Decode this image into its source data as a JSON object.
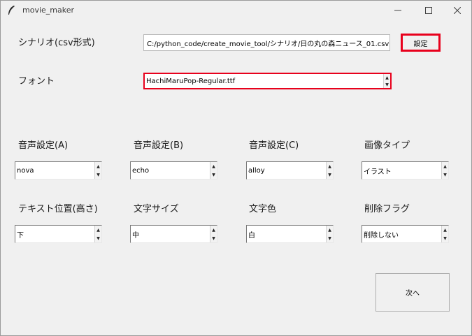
{
  "window": {
    "title": "movie_maker",
    "icon": "feather-icon"
  },
  "scenario": {
    "label": "シナリオ(csv形式)",
    "path": "C:/python_code/create_movie_tool/シナリオ/日の丸の森ニュース_01.csv",
    "set_button": "設定"
  },
  "font": {
    "label": "フォント",
    "value": "HachiMaruPop-Regular.ttf"
  },
  "row1": [
    {
      "label": "音声設定(A)",
      "value": "nova"
    },
    {
      "label": "音声設定(B)",
      "value": "echo"
    },
    {
      "label": "音声設定(C)",
      "value": "alloy"
    },
    {
      "label": "画像タイプ",
      "value": "イラスト"
    }
  ],
  "row2": [
    {
      "label": "テキスト位置(高さ)",
      "value": "下"
    },
    {
      "label": "文字サイズ",
      "value": "中"
    },
    {
      "label": "文字色",
      "value": "白"
    },
    {
      "label": "削除フラグ",
      "value": "削除しない"
    }
  ],
  "next_button": "次へ",
  "highlight_color": "#e8001c"
}
